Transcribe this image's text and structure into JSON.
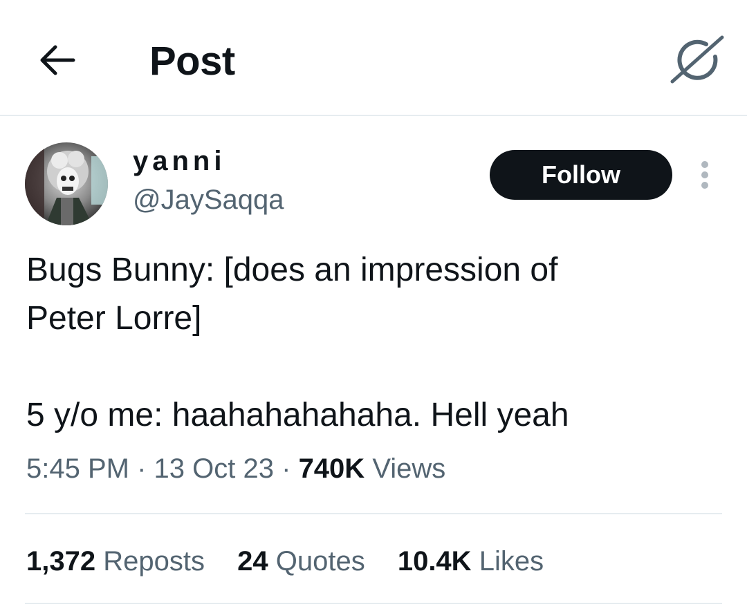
{
  "header": {
    "title": "Post",
    "back_icon": "arrow-left-icon",
    "grok_icon": "grok-icon"
  },
  "author": {
    "display_name": "yanni",
    "handle": "@JaySaqqa",
    "follow_label": "Follow",
    "more_icon": "more-vertical-icon"
  },
  "tweet": {
    "text": "Bugs Bunny: [does an impression of\nPeter Lorre]\n\n5 y/o me: haahahahahaha. Hell yeah"
  },
  "meta": {
    "time": "5:45 PM",
    "sep1": "·",
    "date": "13 Oct 23",
    "sep2": "·",
    "views_count": "740K",
    "views_label": "Views"
  },
  "stats": {
    "reposts_count": "1,372",
    "reposts_label": "Reposts",
    "quotes_count": "24",
    "quotes_label": "Quotes",
    "likes_count": "10.4K",
    "likes_label": "Likes"
  },
  "colors": {
    "text_primary": "#0f1419",
    "text_secondary": "#536471",
    "border": "#e6ecf0",
    "button_bg": "#0f1419",
    "button_text": "#ffffff"
  }
}
